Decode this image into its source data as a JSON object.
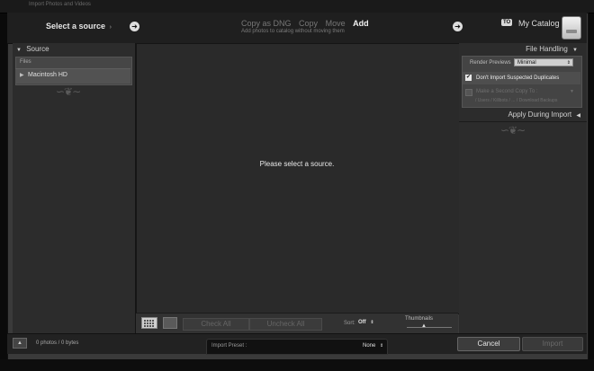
{
  "window": {
    "title": "Import Photos and Videos"
  },
  "header": {
    "select_source": "Select a source",
    "source_chevron": "›",
    "modes": [
      "Copy as DNG",
      "Copy",
      "Move",
      "Add"
    ],
    "active_mode": "Add",
    "mode_description": "Add photos to catalog without moving them",
    "to_badge": "TO",
    "catalog": "My Catalog"
  },
  "source_panel": {
    "title": "Source",
    "files_label": "Files",
    "volume": "Macintosh HD"
  },
  "center": {
    "message": "Please select a source."
  },
  "toolbar": {
    "check_all": "Check All",
    "uncheck_all": "Uncheck All",
    "sort_label": "Sort:",
    "sort_value": "Off",
    "thumbnails_label": "Thumbnails"
  },
  "file_handling": {
    "title": "File Handling",
    "render_label": "Render Previews",
    "render_value": "Minimal",
    "dont_import_dupes": "Don't Import Suspected Duplicates",
    "dupes_checked": true,
    "second_copy": "Make a Second Copy To :",
    "second_copy_path": "/ Users / Killbots / ... / Download Backups"
  },
  "apply_during_import": {
    "title": "Apply During Import"
  },
  "bottom": {
    "photo_count": "0 photos / 0 bytes",
    "preset_label": "Import Preset :",
    "preset_value": "None",
    "cancel": "Cancel",
    "import": "Import"
  },
  "colors": {
    "panel_bg": "#2c2c2c",
    "center_bg": "#2a2a2a",
    "text_active": "#f2f2f2",
    "text_dim": "#777777"
  }
}
